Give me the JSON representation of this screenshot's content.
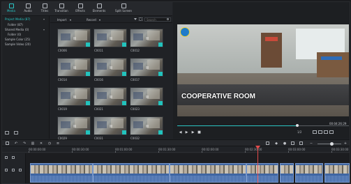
{
  "toolbar": {
    "items": [
      {
        "label": "Media",
        "icon": "folder-icon",
        "active": true
      },
      {
        "label": "Audio",
        "icon": "music-note-icon",
        "active": false
      },
      {
        "label": "Titles",
        "icon": "text-icon",
        "active": false
      },
      {
        "label": "Transition",
        "icon": "transition-icon",
        "active": false
      },
      {
        "label": "Effects",
        "icon": "effects-icon",
        "active": false
      },
      {
        "label": "Elements",
        "icon": "elements-icon",
        "active": false
      },
      {
        "label": "Split Screen",
        "icon": "split-screen-icon",
        "active": false
      }
    ],
    "export_label": "EXPORT"
  },
  "library": {
    "items": [
      {
        "label": "Project Media (87)",
        "active": true
      },
      {
        "label": "Folder (87)",
        "sub": true
      },
      {
        "label": "Shared Media (0)"
      },
      {
        "label": "Folder (0)",
        "sub": true
      },
      {
        "label": "Sample Color (25)"
      },
      {
        "label": "Sample Video (20)"
      }
    ]
  },
  "media": {
    "filters": {
      "import": "Import",
      "record": "Record"
    },
    "search_placeholder": "Search",
    "thumbnails": [
      {
        "caption": "C0006"
      },
      {
        "caption": "C0011"
      },
      {
        "caption": "C0012"
      },
      {
        "caption": "C0014"
      },
      {
        "caption": "C0016"
      },
      {
        "caption": "C0017"
      },
      {
        "caption": "C0019"
      },
      {
        "caption": "C0021"
      },
      {
        "caption": "C0023"
      },
      {
        "caption": "C0029"
      },
      {
        "caption": "C0031"
      },
      {
        "caption": "C0032"
      }
    ]
  },
  "preview": {
    "caption": "COOPERATIVE ROOM",
    "timecode": "00:04:26:29",
    "quality": "1/2",
    "progress": 0.7
  },
  "timeline": {
    "ticks": [
      "00:00:00:00",
      "00:00:30:00",
      "00:01:00:00",
      "00:01:30:00",
      "00:02:00:00",
      "00:02:30:00",
      "00:03:00:00",
      "00:03:30:00"
    ],
    "zoom": 0.5
  },
  "colors": {
    "accent": "#29c7c6",
    "playhead": "#e44b4b",
    "clip": "#3f66a3"
  }
}
